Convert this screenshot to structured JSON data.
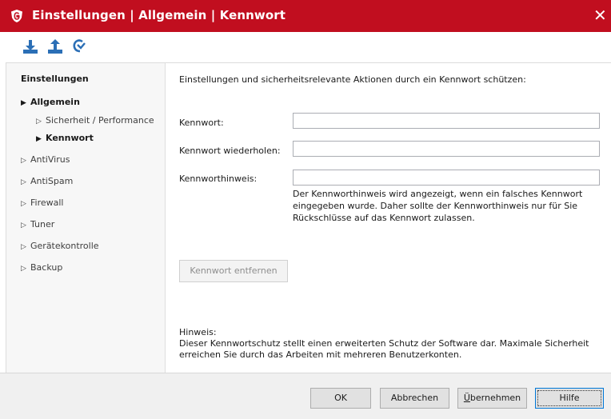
{
  "window": {
    "title": "Einstellungen | Allgemein | Kennwort",
    "close_glyph": "✕",
    "icons": [
      "shield-logo-icon",
      "import-icon",
      "export-icon",
      "reset-icon",
      "close-icon"
    ],
    "accent_color": "#c10e1f"
  },
  "sidebar": {
    "title": "Einstellungen",
    "items": [
      {
        "label": "Allgemein",
        "expanded": true
      },
      {
        "label": "Sicherheit / Performance"
      },
      {
        "label": "Kennwort",
        "selected": true
      },
      {
        "label": "AntiVirus"
      },
      {
        "label": "AntiSpam"
      },
      {
        "label": "Firewall"
      },
      {
        "label": "Tuner"
      },
      {
        "label": "Gerätekontrolle"
      },
      {
        "label": "Backup"
      }
    ]
  },
  "main": {
    "intro": "Einstellungen und sicherheitsrelevante Aktionen durch ein Kennwort schützen:",
    "fields": [
      {
        "label": "Kennwort:",
        "value": ""
      },
      {
        "label": "Kennwort wiederholen:",
        "value": ""
      },
      {
        "label": "Kennworthinweis:",
        "value": ""
      }
    ],
    "hint_lines": [
      "Der Kennworthinweis wird angezeigt, wenn ein falsches Kennwort",
      "eingegeben wurde. Daher sollte der Kennworthinweis nur für Sie",
      "Rückschlüsse auf das Kennwort zulassen."
    ],
    "remove_button": "Kennwort entfernen",
    "note_title": "Hinweis:",
    "note_lines": [
      "Dieser Kennwortschutz stellt einen erweiterten Schutz der Software dar. Maximale Sicherheit",
      "erreichen Sie durch das Arbeiten mit mehreren Benutzerkonten."
    ]
  },
  "footer": {
    "ok": "OK",
    "cancel": "Abbrechen",
    "apply_prefix": "Ü",
    "apply_rest": "bernehmen",
    "help": "Hilfe"
  }
}
